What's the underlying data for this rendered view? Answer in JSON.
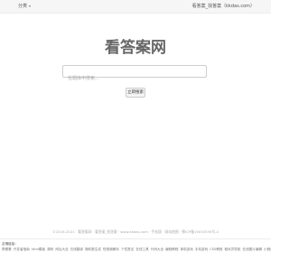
{
  "header": {
    "category_label": "分类",
    "site_label": "看答案_找答案（kkdas.com）"
  },
  "logo": {
    "text": "看答案网"
  },
  "search": {
    "placeholder": "在题库中搜索...",
    "value": "",
    "button_label": "立即搜索"
  },
  "footer": {
    "copyright": "©2019-2021 · 看答案网 · 看答案_找答案 · www.kkdas.com · 手机版 · 网站地图 · 鄂ICP备19033539号-4",
    "links_label": "友情链接：",
    "links": [
      "帮看看",
      "开发者指南",
      "html模板",
      "源码",
      "网址大全",
      "在线翻译",
      "随机数生成",
      "短视频解析",
      "个性签名",
      "在线工具",
      "代码大全",
      "编程教程",
      "单机游戏",
      "手机游戏",
      "CSS教程",
      "程序员导航",
      "在线图片编辑",
      "小程序开发",
      "前端框架",
      "人工智能",
      "大数据",
      "区块链",
      "算法",
      "云计算",
      "网络安全"
    ]
  }
}
